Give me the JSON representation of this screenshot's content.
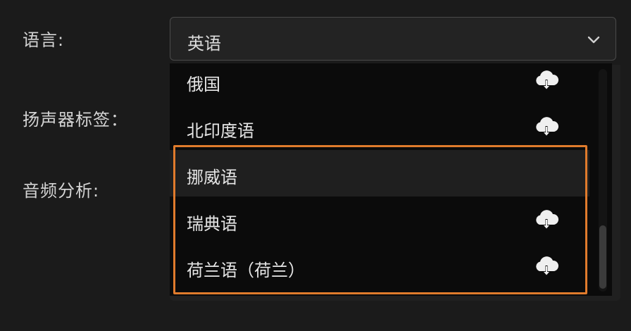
{
  "form": {
    "language_label": "语言:",
    "speaker_label": "扬声器标签：",
    "audio_label": "音频分析:"
  },
  "language_select": {
    "selected": "英语",
    "chevron_icon": "chevron-down-icon"
  },
  "dropdown": {
    "options": [
      {
        "label": "俄国",
        "icon": "cloud-download-icon"
      },
      {
        "label": "北印度语",
        "icon": "cloud-download-icon"
      },
      {
        "label": "挪威语",
        "icon": null,
        "hovered": true
      },
      {
        "label": "瑞典语",
        "icon": "cloud-download-icon"
      },
      {
        "label": "荷兰语（荷兰）",
        "icon": "cloud-download-icon"
      }
    ]
  },
  "colors": {
    "background": "#1b1b1b",
    "dropdown_background": "#0b0b0b",
    "highlight_border": "#e07b2c",
    "text": "#e6e6e6"
  }
}
